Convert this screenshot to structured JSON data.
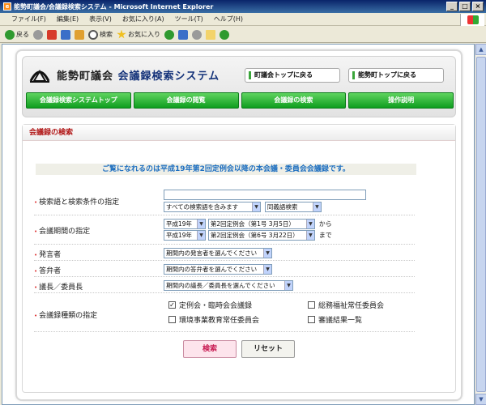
{
  "window": {
    "title": "能勢町議会/会議録検索システム - Microsoft Internet Explorer",
    "controls": [
      "_",
      "□",
      "×"
    ]
  },
  "menu": [
    "ファイル(F)",
    "編集(E)",
    "表示(V)",
    "お気に入り(A)",
    "ツール(T)",
    "ヘルプ(H)"
  ],
  "toolbar": {
    "back": "戻る",
    "search": "検索",
    "favorites": "お気に入り"
  },
  "site": {
    "title_part1": "能勢町議会",
    "title_part2": "会議録検索システム",
    "link_council_top": "町議会トップに戻る",
    "link_town_top": "能勢町トップに戻る"
  },
  "nav": [
    "会議録検索システムトップ",
    "会議録の閲覧",
    "会議録の検索",
    "操作説明"
  ],
  "section": {
    "title": "会議録の検索",
    "notice": "ご覧になれるのは平成19年第2回定例会以降の本会議・委員会会議録です。"
  },
  "form": {
    "keyword_label": "検索語と検索条件の指定",
    "keyword_value": "",
    "match_option": "すべての検索語を含みます",
    "synonym_option": "同義語検索",
    "period_label": "会議期間の指定",
    "from_year": "平成19年",
    "from_session": "第2回定例会（第1号 3月5日）",
    "from_suffix": "から",
    "to_year": "平成19年",
    "to_session": "第2回定例会（第6号 3月22日）",
    "to_suffix": "まで",
    "speaker_label": "発言者",
    "speaker_option": "期間内の発言者を選んでください",
    "answerer_label": "答弁者",
    "answerer_option": "期間内の答弁者を選んでください",
    "chair_label": "議長／委員長",
    "chair_option": "期間内の議長／委員長を選んでください",
    "type_label": "会議録種類の指定",
    "types": [
      {
        "label": "定例会・臨時会会議録",
        "checked": true
      },
      {
        "label": "総務福祉常任委員会",
        "checked": false
      },
      {
        "label": "環境事業教育常任委員会",
        "checked": false
      },
      {
        "label": "審議結果一覧",
        "checked": false
      }
    ],
    "search_button": "検索",
    "reset_button": "リセット"
  }
}
